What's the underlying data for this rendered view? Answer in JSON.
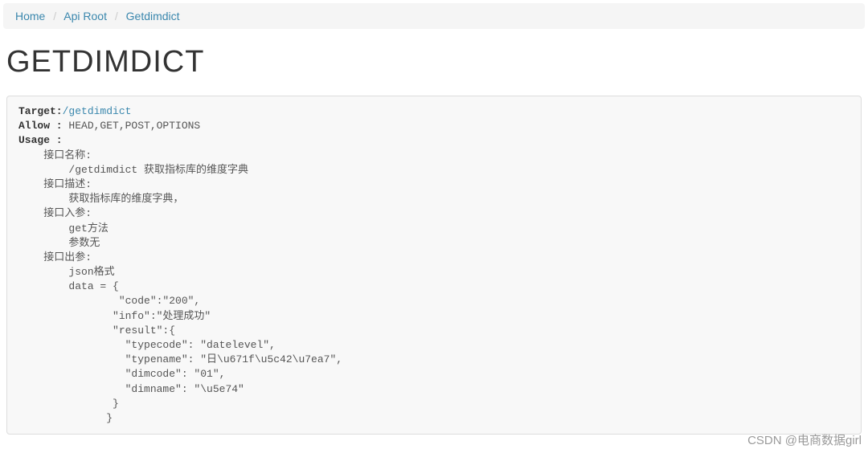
{
  "breadcrumb": {
    "home": "Home",
    "apiRoot": "Api Root",
    "getdimdict": "Getdimdict"
  },
  "pageTitle": "GETDIMDICT",
  "api": {
    "targetLabel": "Target:",
    "targetLink": "/getdimdict",
    "allowLabel": "Allow :",
    "allowValue": " HEAD,GET,POST,OPTIONS",
    "usageLabel": "Usage :",
    "body": "    接口名称:\n        /getdimdict 获取指标库的维度字典\n    接口描述:\n        获取指标库的维度字典，\n    接口入参:\n        get方法\n        参数无\n    接口出参:\n        json格式\n        data = {\n                \"code\":\"200\",\n               \"info\":\"处理成功\"\n               \"result\":{\n                 \"typecode\": \"datelevel\",\n                 \"typename\": \"日\\u671f\\u5c42\\u7ea7\",\n                 \"dimcode\": \"01\",\n                 \"dimname\": \"\\u5e74\"\n               }\n              }"
  },
  "watermark": "CSDN @电商数据girl"
}
